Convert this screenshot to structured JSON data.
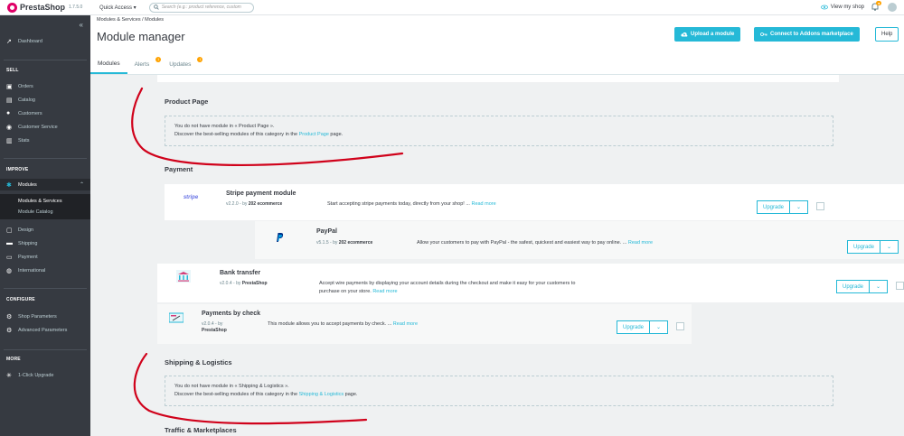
{
  "topbar": {
    "brand": "PrestaShop",
    "version": "1.7.5.0",
    "quick_access": "Quick Access ▾",
    "search_placeholder": "Search (e.g.: product reference, custom",
    "view_shop": "View my shop"
  },
  "sidebar": {
    "collapse": "«",
    "dashboard": "Dashboard",
    "sec_sell": "SELL",
    "orders": "Orders",
    "catalog": "Catalog",
    "customers": "Customers",
    "customer_service": "Customer Service",
    "stats": "Stats",
    "sec_improve": "IMPROVE",
    "modules": "Modules",
    "modules_services": "Modules & Services",
    "module_catalog": "Module Catalog",
    "design": "Design",
    "shipping": "Shipping",
    "payment": "Payment",
    "international": "International",
    "sec_configure": "CONFIGURE",
    "shop_parameters": "Shop Parameters",
    "advanced_parameters": "Advanced Parameters",
    "sec_more": "MORE",
    "one_click": "1-Click Upgrade"
  },
  "header": {
    "breadcrumb": "Modules & Services  /  Modules",
    "title": "Module manager",
    "upload_btn": "Upload a module",
    "connect_btn": "Connect to Addons marketplace",
    "help_btn": "Help"
  },
  "tabs": {
    "modules": "Modules",
    "alerts": "Alerts",
    "updates": "Updates",
    "alerts_count": "1",
    "updates_count": "1"
  },
  "sections": {
    "product_page": {
      "title": "Product Page",
      "line1": "You do not have module in « Product Page ».",
      "line2_pre": "Discover the best-selling modules of this category in the ",
      "line2_link": "Product Page",
      "line2_post": " page."
    },
    "payment_title": "Payment",
    "shipping": {
      "title": "Shipping & Logistics",
      "line1": "You do not have module in « Shipping & Logistics ».",
      "line2_pre": "Discover the best-selling modules of this category in the ",
      "line2_link": "Shipping & Logistics",
      "line2_post": " page."
    },
    "traffic_title": "Traffic & Marketplaces"
  },
  "modules": [
    {
      "name": "Stripe payment module",
      "logo": "stripe",
      "version": "v2.2.0 - by ",
      "author": "202 ecommerce",
      "desc": "Start accepting stripe payments today, directly from your shop! ... ",
      "more": "Read more",
      "action": "Upgrade"
    },
    {
      "name": "PayPal",
      "logo": "paypal-icon",
      "version": "v5.1.5 - by ",
      "author": "202 ecommerce",
      "desc": "Allow your customers to pay with PayPal - the safest, quickest and easiest way to pay online. ... ",
      "more": "Read more",
      "action": "Upgrade"
    },
    {
      "name": "Bank transfer",
      "logo": "bank-icon",
      "version": "v2.0.4 - by ",
      "author": "PrestaShop",
      "desc": "Accept wire payments by displaying your account details during the checkout and make it easy for your customers to",
      "desc2": "purchase on your store. ",
      "more": "Read more",
      "action": "Upgrade"
    },
    {
      "name": "Payments by check",
      "logo": "check-icon",
      "version": "v2.0.4 - by",
      "author": "PrestaShop",
      "desc": "This module allows you to accept payments by check. ... ",
      "more": "Read more",
      "action": "Upgrade"
    }
  ],
  "colors": {
    "accent": "#25b9d7",
    "sidebar": "#363a41",
    "annotation": "#d0021b"
  }
}
